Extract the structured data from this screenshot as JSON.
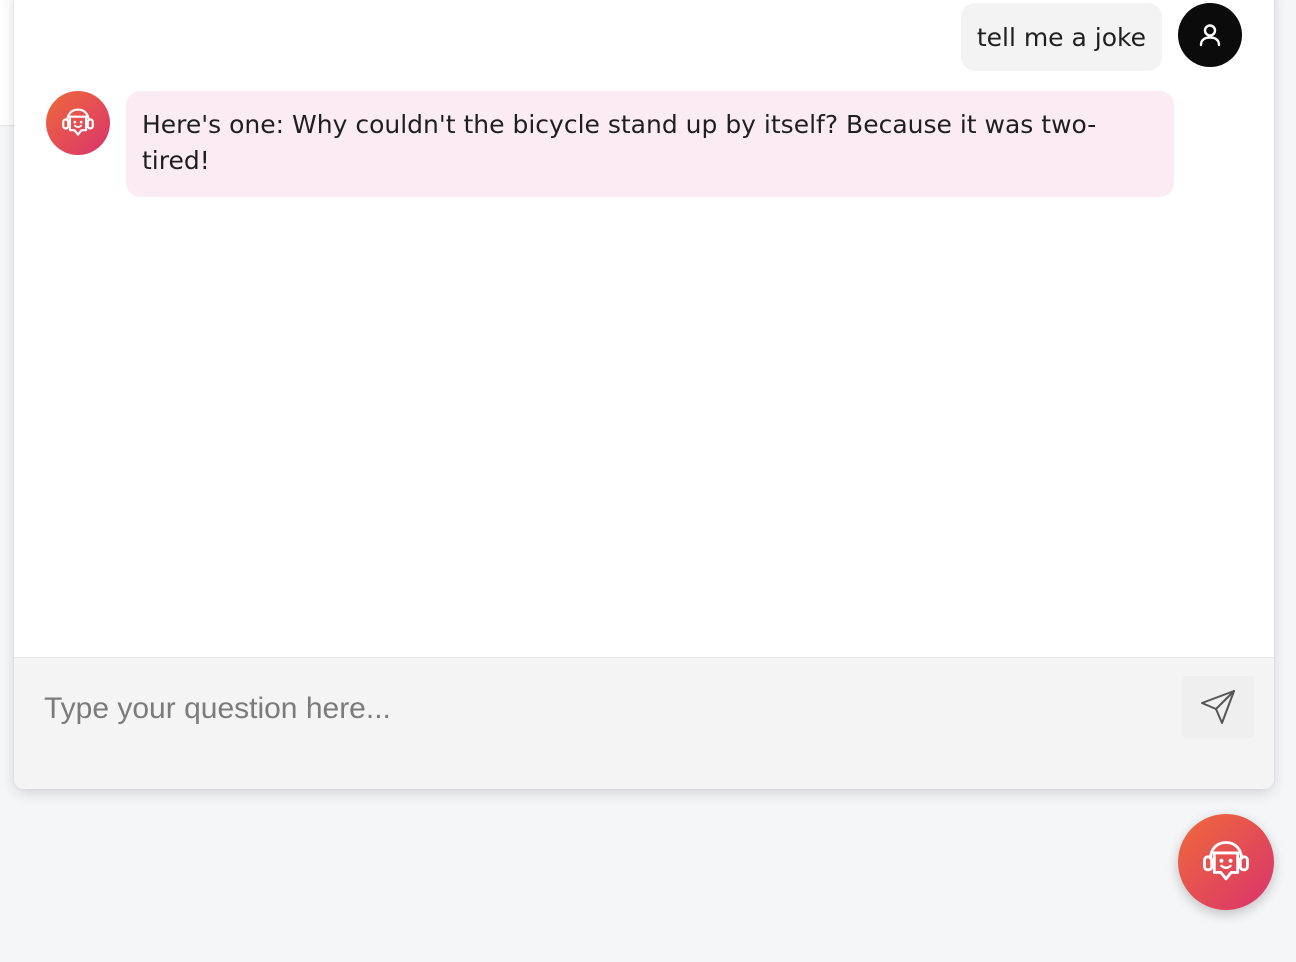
{
  "conversation": {
    "user_message": "tell me a joke",
    "bot_message": "Here's one: Why couldn't the bicycle stand up by itself? Because it was two-tired!"
  },
  "composer": {
    "placeholder": "Type your question here...",
    "value": ""
  },
  "icons": {
    "user_avatar": "user-icon",
    "bot_avatar": "bot-headset-icon",
    "send": "paper-plane-icon",
    "launcher": "bot-headset-icon"
  },
  "colors": {
    "accent_start": "#ef6a3a",
    "accent_end": "#d9336d",
    "bot_bubble": "#fbecf3",
    "user_bubble": "#f3f3f4",
    "user_avatar": "#0b0b0b"
  }
}
